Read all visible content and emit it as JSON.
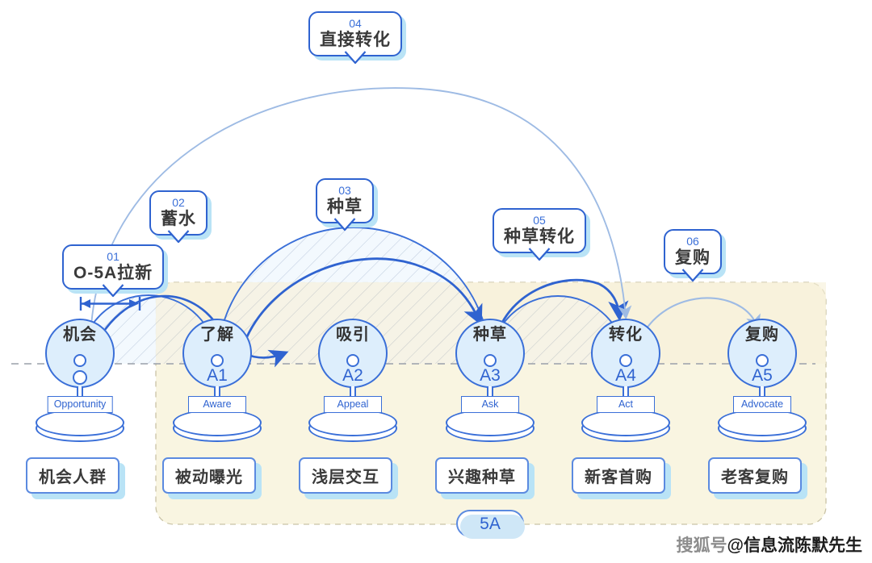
{
  "diagram": {
    "title_badge": "5A",
    "baseline_note": "dashed baseline through node centers"
  },
  "callouts": [
    {
      "id": "c01",
      "num": "01",
      "label": "O-5A拉新"
    },
    {
      "id": "c02",
      "num": "02",
      "label": "蓄水"
    },
    {
      "id": "c03",
      "num": "03",
      "label": "种草"
    },
    {
      "id": "c04",
      "num": "04",
      "label": "直接转化"
    },
    {
      "id": "c05",
      "num": "05",
      "label": "种草转化"
    },
    {
      "id": "c06",
      "num": "06",
      "label": "复购"
    }
  ],
  "nodes": [
    {
      "id": "n-o",
      "cn": "机会",
      "code": "",
      "en": "Opportunity",
      "bottom": "机会人群"
    },
    {
      "id": "n-a1",
      "cn": "了解",
      "code": "A1",
      "en": "Aware",
      "bottom": "被动曝光"
    },
    {
      "id": "n-a2",
      "cn": "吸引",
      "code": "A2",
      "en": "Appeal",
      "bottom": "浅层交互"
    },
    {
      "id": "n-a3",
      "cn": "种草",
      "code": "A3",
      "en": "Ask",
      "bottom": "兴趣种草"
    },
    {
      "id": "n-a4",
      "cn": "转化",
      "code": "A4",
      "en": "Act",
      "bottom": "新客首购"
    },
    {
      "id": "n-a5",
      "cn": "复购",
      "code": "A5",
      "en": "Advocate",
      "bottom": "老客复购"
    }
  ],
  "watermark": {
    "prefix": "搜狐号",
    "name": "@信息流陈默先生"
  },
  "colors": {
    "accent_blue": "#2f63d0",
    "node_blue": "#3a6fd8",
    "node_fill": "#ddeefc",
    "arc_light": "#8fb4e8",
    "hatch_blue_fill": "#f2f8fe",
    "region_yellow": "#f9f5e1",
    "callout_shadow": "#b9e3f6",
    "text_dark": "#3a3a3a"
  }
}
